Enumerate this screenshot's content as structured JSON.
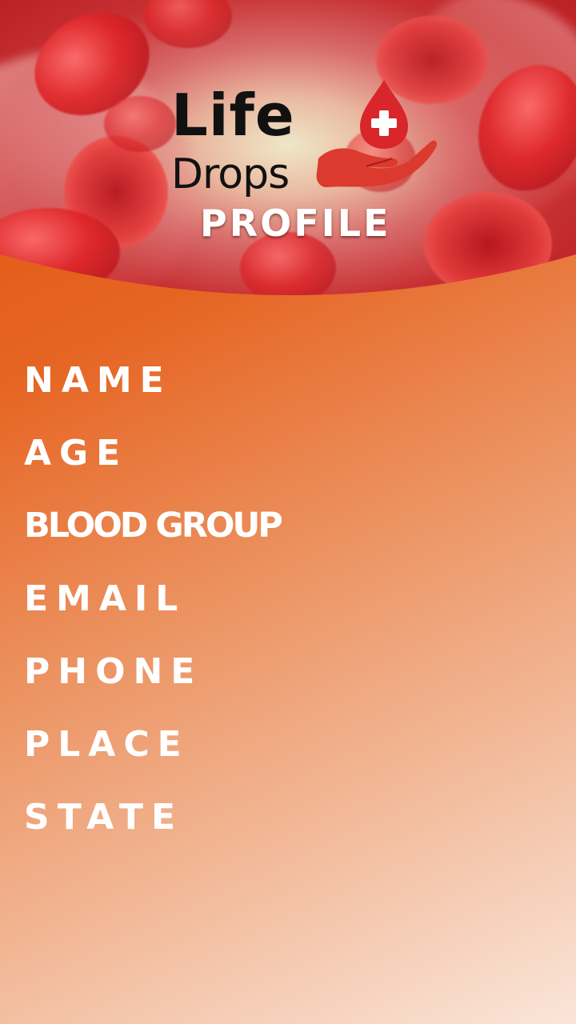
{
  "header": {
    "logo_line1": "Life",
    "logo_line2": "Drops",
    "title": "PROFILE"
  },
  "profile_fields": [
    {
      "label": "NAME"
    },
    {
      "label": "AGE"
    },
    {
      "label": "BLOOD GROUP"
    },
    {
      "label": "EMAIL"
    },
    {
      "label": "PHONE"
    },
    {
      "label": "PLACE"
    },
    {
      "label": "STATE"
    }
  ],
  "icons": {
    "logo": "blood-drop-hand-icon"
  },
  "colors": {
    "accent": "#e45d1a",
    "brand_red": "#d8262b",
    "text": "#ffffff"
  }
}
